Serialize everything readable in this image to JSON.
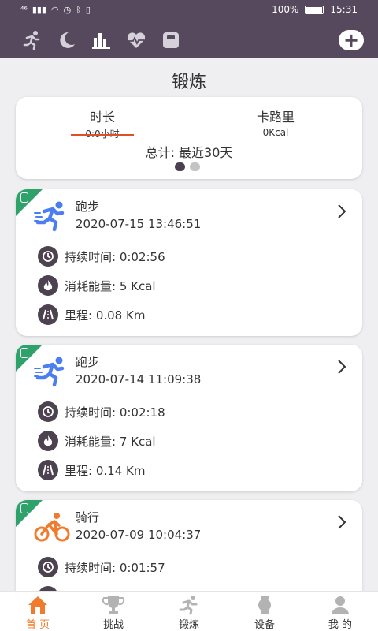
{
  "status": {
    "network": "⁴⁶",
    "battery": "100%",
    "time": "15:31"
  },
  "header": {
    "categories": [
      {
        "name": "running"
      },
      {
        "name": "sleep"
      },
      {
        "name": "stats"
      },
      {
        "name": "heart-rate"
      },
      {
        "name": "weight"
      }
    ]
  },
  "page": {
    "title": "锻炼"
  },
  "summary": {
    "duration_label": "时长",
    "duration_value": "0:0小时",
    "calorie_label": "卡路里",
    "calorie_value": "0Kcal",
    "total": "总计: 最近30天"
  },
  "records": [
    {
      "sport": "跑步",
      "datetime": "2020-07-15 13:46:51",
      "duration": "持续时间: 0:02:56",
      "energy": "消耗能量: 5 Kcal",
      "distance": "里程: 0.08 Km",
      "icon": "running-icon"
    },
    {
      "sport": "跑步",
      "datetime": "2020-07-14 11:09:38",
      "duration": "持续时间: 0:02:18",
      "energy": "消耗能量: 7 Kcal",
      "distance": "里程: 0.14 Km",
      "icon": "running-icon"
    },
    {
      "sport": "骑行",
      "datetime": "2020-07-09 10:04:37",
      "duration": "持续时间: 0:01:57",
      "icon": "cycling-icon"
    }
  ],
  "tabs": [
    {
      "label": "首 页",
      "icon": "home-icon"
    },
    {
      "label": "挑战",
      "icon": "trophy-icon"
    },
    {
      "label": "锻炼",
      "icon": "exercise-icon"
    },
    {
      "label": "设备",
      "icon": "watch-icon"
    },
    {
      "label": "我 的",
      "icon": "profile-icon"
    }
  ],
  "colors": {
    "header": "#56495d",
    "accent": "#f07a2d",
    "corner": "#2fa26c",
    "run": "#4b7ef0",
    "ride": "#f07a2d"
  }
}
